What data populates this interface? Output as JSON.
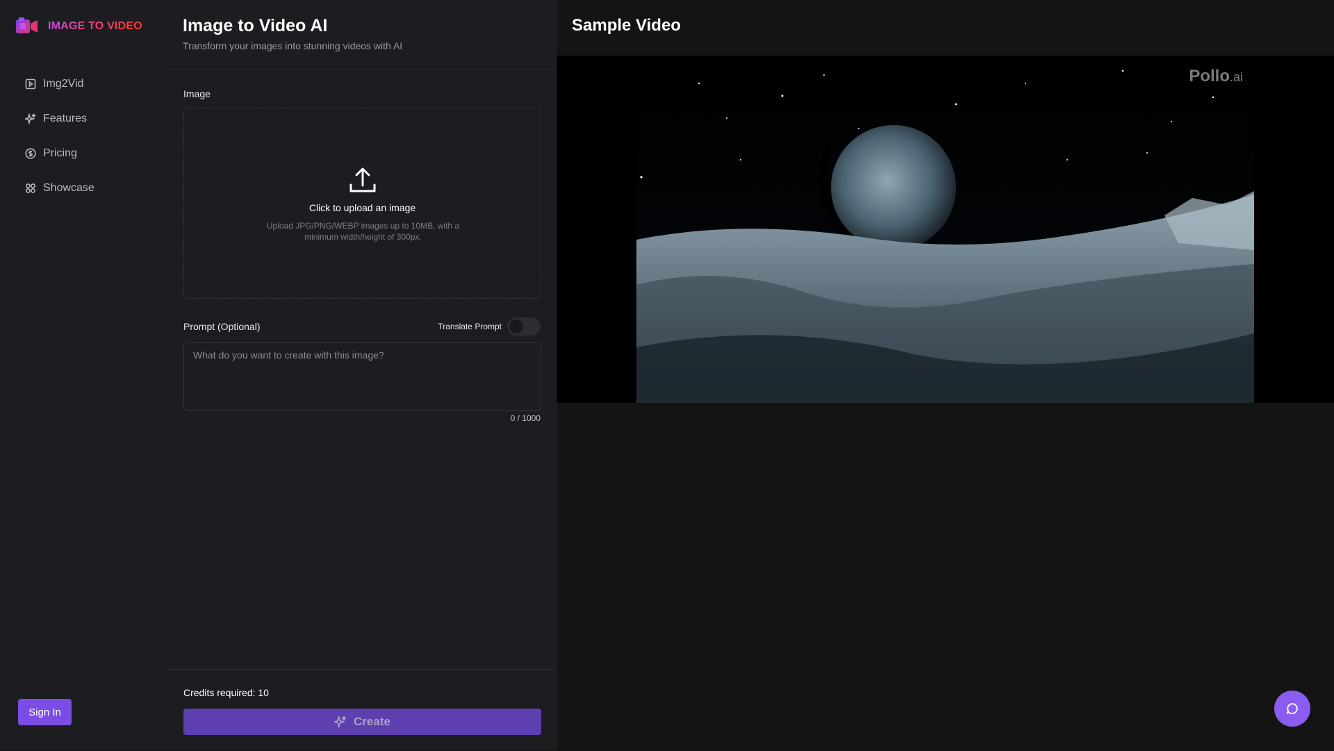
{
  "brand": {
    "name": "IMAGE TO VIDEO"
  },
  "sidebar": {
    "items": [
      {
        "label": "Img2Vid",
        "icon": "play-square-icon"
      },
      {
        "label": "Features",
        "icon": "sparkles-icon"
      },
      {
        "label": "Pricing",
        "icon": "dollar-circle-icon"
      },
      {
        "label": "Showcase",
        "icon": "grid-icon"
      }
    ],
    "signin_label": "Sign In"
  },
  "panel": {
    "title": "Image to Video AI",
    "subtitle": "Transform your images into stunning videos with AI",
    "image_label": "Image",
    "upload_title": "Click to upload an image",
    "upload_hint": "Upload JPG/PNG/WEBP images up to 10MB, with a minimum width/height of 300px.",
    "prompt_label": "Prompt (Optional)",
    "translate_label": "Translate Prompt",
    "translate_enabled": false,
    "prompt_value": "",
    "prompt_placeholder": "What do you want to create with this image?",
    "prompt_counter": "0 / 1000",
    "credits": "Credits required: 10",
    "create_label": "Create"
  },
  "sample": {
    "title": "Sample Video",
    "watermark_main": "Pollo",
    "watermark_suffix": ".ai"
  },
  "colors": {
    "accent": "#7c4de6",
    "create_button": "#5d3fb0",
    "chat_button": "#8a5cf0"
  }
}
